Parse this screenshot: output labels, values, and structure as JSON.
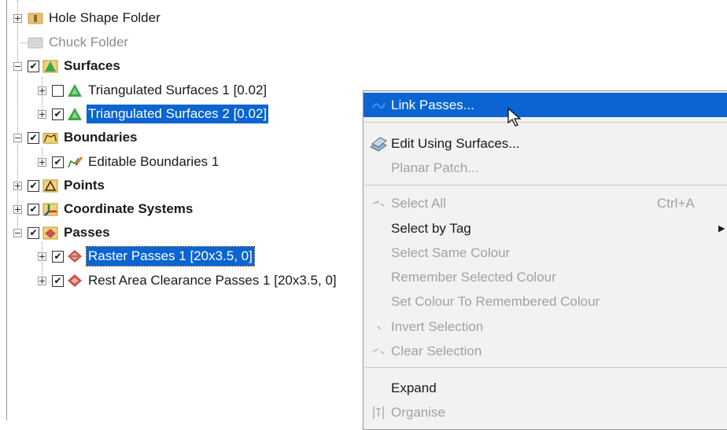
{
  "tree": {
    "items": [
      {
        "label": "Hole Shape Folder"
      },
      {
        "label": "Chuck Folder"
      },
      {
        "label": "Surfaces"
      },
      {
        "label": "Triangulated Surfaces 1 [0.02]"
      },
      {
        "label": "Triangulated Surfaces 2 [0.02]"
      },
      {
        "label": "Boundaries"
      },
      {
        "label": "Editable Boundaries 1"
      },
      {
        "label": "Points"
      },
      {
        "label": "Coordinate Systems"
      },
      {
        "label": "Passes"
      },
      {
        "label": "Raster Passes 1 [20x3.5, 0]"
      },
      {
        "label": "Rest Area Clearance Passes 1 [20x3.5, 0]"
      }
    ],
    "check_mark": "✔"
  },
  "menu": {
    "items": [
      {
        "label": "Link Passes..."
      },
      {
        "label": "Edit Using Surfaces..."
      },
      {
        "label": "Planar Patch..."
      },
      {
        "label": "Select All",
        "shortcut": "Ctrl+A"
      },
      {
        "label": "Select by Tag",
        "arrow": "▶"
      },
      {
        "label": "Select Same Colour"
      },
      {
        "label": "Remember Selected Colour"
      },
      {
        "label": "Set Colour To Remembered Colour"
      },
      {
        "label": "Invert Selection"
      },
      {
        "label": "Clear Selection"
      },
      {
        "label": "Expand"
      },
      {
        "label": "Organise"
      }
    ]
  },
  "colors": {
    "selection": "#0a64d2",
    "menu_bg": "#f2f2f2",
    "disabled_text": "#a2a2a2"
  }
}
